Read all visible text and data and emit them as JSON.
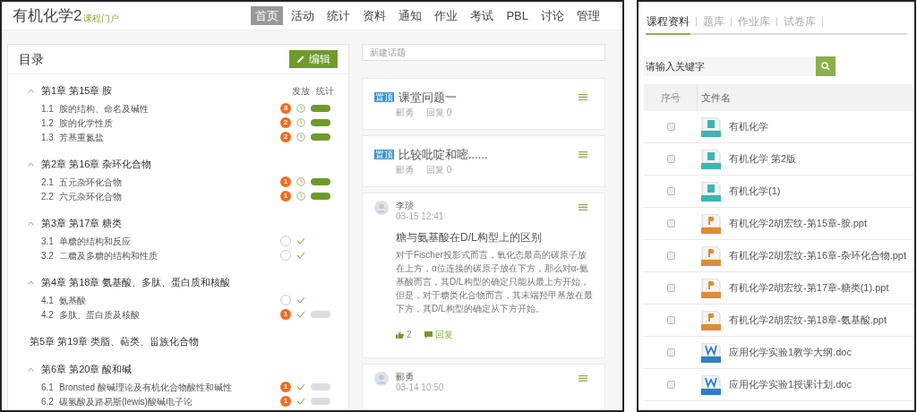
{
  "left": {
    "header": {
      "title": "有机化学2",
      "subtitle": "课程门户"
    },
    "nav": [
      {
        "label": "首页",
        "selected": true
      },
      {
        "label": "活动",
        "selected": false
      },
      {
        "label": "统计",
        "selected": false
      },
      {
        "label": "资料",
        "selected": false
      },
      {
        "label": "通知",
        "selected": false
      },
      {
        "label": "作业",
        "selected": false
      },
      {
        "label": "考试",
        "selected": false
      },
      {
        "label": "PBL",
        "selected": false
      },
      {
        "label": "讨论",
        "selected": false
      },
      {
        "label": "管理",
        "selected": false
      }
    ],
    "outline": {
      "title": "目录",
      "edit_button": "编辑",
      "column_labels": [
        "发放",
        "统计"
      ],
      "chapters": [
        {
          "title": "第1章 第15章 胺",
          "collapsible": true,
          "children": [
            {
              "number": "1.1",
              "title": "胺的结构、命名及碱性",
              "count": "3",
              "kind": "scheduled",
              "stats_ready": true
            },
            {
              "number": "1.2",
              "title": "胺的化学性质",
              "count": "2",
              "kind": "scheduled",
              "stats_ready": true
            },
            {
              "number": "1.3",
              "title": "芳基重氮盐",
              "count": "2",
              "kind": "scheduled",
              "stats_ready": true
            }
          ]
        },
        {
          "title": "第2章 第16章 杂环化合物",
          "collapsible": true,
          "children": [
            {
              "number": "2.1",
              "title": "五元杂环化合物",
              "count": "1",
              "kind": "scheduled",
              "stats_ready": true
            },
            {
              "number": "2.2",
              "title": "六元杂环化合物",
              "count": "1",
              "kind": "scheduled",
              "stats_ready": true
            }
          ]
        },
        {
          "title": "第3章 第17章 糖类",
          "collapsible": true,
          "children": [
            {
              "number": "3.1",
              "title": "单糖的结构和反应",
              "kind": "done"
            },
            {
              "number": "3.2",
              "title": "二糖及多糖的结构和性质",
              "kind": "done"
            }
          ]
        },
        {
          "title": "第4章 第18章 氨基酸、多肽、蛋白质和核酸",
          "collapsible": true,
          "children": [
            {
              "number": "4.1",
              "title": "氨基酸",
              "kind": "done"
            },
            {
              "number": "4.2",
              "title": "多肽、蛋白质及核酸",
              "count": "1",
              "kind": "done",
              "stats_ready": false
            }
          ]
        },
        {
          "title": "第5章 第19章 类脂、萜类、甾族化合物",
          "collapsible": false
        },
        {
          "title": "第6章 第20章 酸和碱",
          "collapsible": true,
          "children": [
            {
              "number": "6.1",
              "title": "Bronsted 酸碱理论及有机化合物酸性和碱性",
              "count": "1",
              "kind": "done",
              "stats_ready": false
            },
            {
              "number": "6.2",
              "title": "碳氢酸及路易斯(lewis)酸碱电子论",
              "count": "1",
              "kind": "done",
              "stats_ready": false
            }
          ]
        }
      ]
    },
    "discussion": {
      "new_topic_placeholder": "新建话题",
      "posts": [
        {
          "kind": "pinned",
          "badge": "置顶",
          "title": "课堂问题一",
          "author": "郦勇",
          "replies": "回复 0"
        },
        {
          "kind": "pinned",
          "badge": "置顶",
          "title": "比较吡啶和嘧......",
          "author": "郦勇",
          "replies": "回复 0"
        },
        {
          "kind": "post",
          "author": "李琰",
          "time": "03-15 12:41",
          "title": "糖与氨基酸在D/L构型上的区别",
          "body": "对于Fischer投影式而言，氧化态最高的碳原子放在上方，α位连接的碳原子放在下方，那么对α-氨基酸而言，其D/L构型的确定只能从最上方开始，但是，对于糖类化合物而言，其末端羟甲基放在最下方，其D/L构型的确定从下方开始。",
          "likes": "2",
          "reply": "回复"
        },
        {
          "kind": "post",
          "author": "郦勇",
          "time": "03-14 10:50"
        }
      ]
    }
  },
  "right": {
    "tabs": [
      {
        "label": "课程资料",
        "selected": true
      },
      {
        "label": "题库",
        "selected": false
      },
      {
        "label": "作业库",
        "selected": false
      },
      {
        "label": "试卷库",
        "selected": false
      }
    ],
    "search": {
      "placeholder": "请输入关键字"
    },
    "table": {
      "columns": [
        "序号",
        "文件名"
      ],
      "rows": [
        {
          "checked": false,
          "kind": "book",
          "name": "有机化学"
        },
        {
          "checked": false,
          "kind": "book",
          "name": "有机化学 第2版"
        },
        {
          "checked": false,
          "kind": "book",
          "name": "有机化学(1)"
        },
        {
          "checked": false,
          "kind": "ppt",
          "name": "有机化学2胡宏纹-第15章-胺.ppt"
        },
        {
          "checked": false,
          "kind": "ppt",
          "name": "有机化学2胡宏纹-第16章-杂环化合物.ppt"
        },
        {
          "checked": false,
          "kind": "ppt",
          "name": "有机化学2胡宏纹-第17章-糖类(1).ppt"
        },
        {
          "checked": false,
          "kind": "ppt",
          "name": "有机化学2胡宏纹-第18章-氨基酸.ppt"
        },
        {
          "checked": false,
          "kind": "word",
          "name": "应用化学实验1教学大纲.doc"
        },
        {
          "checked": false,
          "kind": "word",
          "name": "应用化学实验1授课计划.doc"
        }
      ]
    }
  }
}
